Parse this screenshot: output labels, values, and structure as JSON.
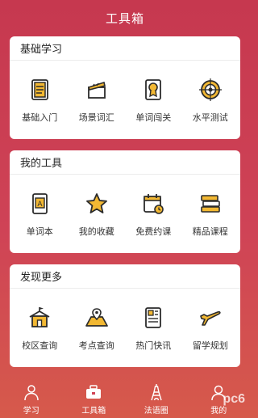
{
  "header": {
    "title": "工具箱"
  },
  "sections": [
    {
      "title": "基础学习",
      "items": [
        {
          "label": "基础入门",
          "icon": "book-icon"
        },
        {
          "label": "场景词汇",
          "icon": "clapperboard-icon"
        },
        {
          "label": "单词闯关",
          "icon": "badge-icon"
        },
        {
          "label": "水平测试",
          "icon": "target-icon"
        }
      ]
    },
    {
      "title": "我的工具",
      "items": [
        {
          "label": "单词本",
          "icon": "wordbook-icon"
        },
        {
          "label": "我的收藏",
          "icon": "star-icon"
        },
        {
          "label": "免费约课",
          "icon": "calendar-icon"
        },
        {
          "label": "精品课程",
          "icon": "books-stack-icon"
        }
      ]
    },
    {
      "title": "发现更多",
      "items": [
        {
          "label": "校区查询",
          "icon": "school-icon"
        },
        {
          "label": "考点查询",
          "icon": "map-pin-icon"
        },
        {
          "label": "热门快讯",
          "icon": "newspaper-icon"
        },
        {
          "label": "留学规划",
          "icon": "airplane-icon"
        }
      ]
    }
  ],
  "tabs": [
    {
      "label": "学习",
      "icon": "student-icon"
    },
    {
      "label": "工具箱",
      "icon": "toolbox-icon"
    },
    {
      "label": "法语圈",
      "icon": "eiffel-tower-icon"
    },
    {
      "label": "我的",
      "icon": "user-icon"
    }
  ],
  "watermark": "pc6",
  "colors": {
    "accent": "#f2b833",
    "line": "#2b2b2b",
    "background": "#c6384f"
  }
}
